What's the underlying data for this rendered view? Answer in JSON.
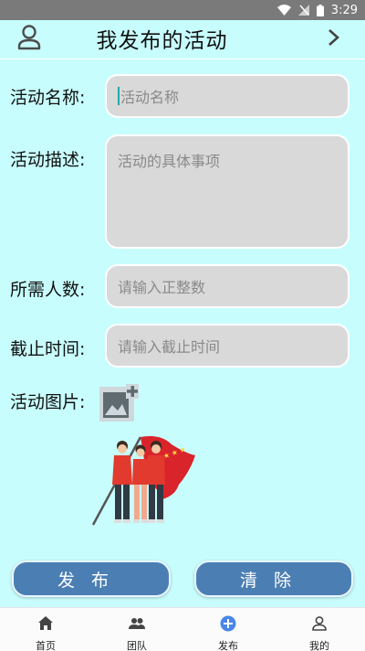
{
  "status": {
    "time": "3:29"
  },
  "header": {
    "title": "我发布的活动"
  },
  "form": {
    "name": {
      "label": "活动名称:",
      "placeholder": "活动名称"
    },
    "desc": {
      "label": "活动描述:",
      "placeholder": "活动的具体事项"
    },
    "people": {
      "label": "所需人数:",
      "placeholder": "请输入正整数"
    },
    "deadline": {
      "label": "截止时间:",
      "placeholder": "请输入截止时间"
    },
    "image": {
      "label": "活动图片:"
    }
  },
  "actions": {
    "publish": "发布",
    "clear": "清除"
  },
  "tabs": [
    {
      "label": "首页",
      "icon": "home-icon"
    },
    {
      "label": "团队",
      "icon": "team-icon"
    },
    {
      "label": "发布",
      "icon": "publish-icon"
    },
    {
      "label": "我的",
      "icon": "profile-icon"
    }
  ],
  "colors": {
    "background": "#c8fdfd",
    "button": "#4b7fb4",
    "active_tab": "#4a86e8"
  }
}
